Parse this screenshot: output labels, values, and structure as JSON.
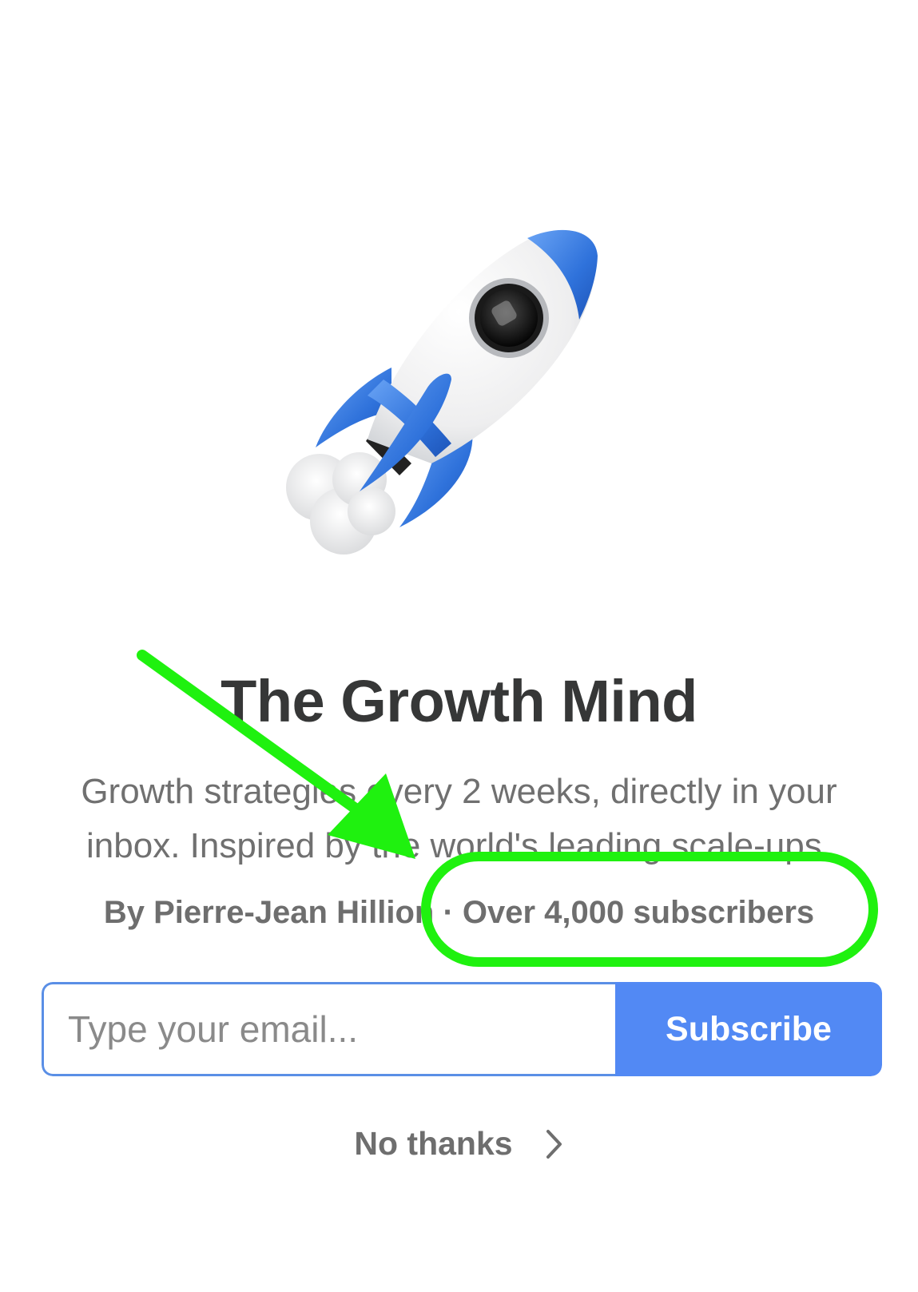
{
  "publication": {
    "title": "The Growth Mind",
    "description": "Growth strategies every 2 weeks, directly in your inbox. Inspired by the world's leading scale-ups.",
    "author_line": "By Pierre-Jean Hillion",
    "separator": "·",
    "subscriber_count": "Over 4,000 subscribers"
  },
  "form": {
    "email_placeholder": "Type your email...",
    "email_value": "",
    "subscribe_label": "Subscribe"
  },
  "no_thanks": {
    "label": "No thanks",
    "icon": "chevron-right-icon"
  },
  "annotation": {
    "highlight_color": "#1ff10f",
    "shapes": [
      "arrow",
      "ellipse"
    ]
  },
  "colors": {
    "accent": "#5289f4",
    "input_border": "#5a8fe6",
    "title": "#363737",
    "body_text": "#707070",
    "rocket_blue": "#2f72db"
  },
  "logo": "rocket-emoji"
}
